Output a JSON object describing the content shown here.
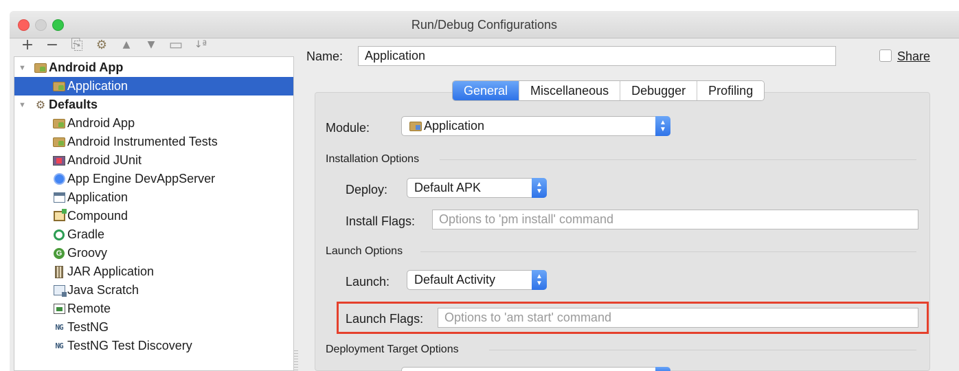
{
  "window": {
    "title": "Run/Debug Configurations"
  },
  "toolbar": {
    "buttons": [
      {
        "name": "add",
        "glyph": "+"
      },
      {
        "name": "remove",
        "glyph": "−"
      },
      {
        "name": "copy",
        "glyph": "⎘"
      },
      {
        "name": "edit-defaults",
        "glyph": "🔧"
      },
      {
        "name": "move-up",
        "glyph": "▲"
      },
      {
        "name": "move-down",
        "glyph": "▼"
      },
      {
        "name": "folder",
        "glyph": "▭"
      },
      {
        "name": "sort",
        "glyph": "↓ª"
      }
    ]
  },
  "tree": {
    "android_app": {
      "label": "Android App"
    },
    "application_selected": {
      "label": "Application"
    },
    "defaults": {
      "label": "Defaults"
    },
    "items": [
      {
        "label": "Android App",
        "icon": "android-app-icon"
      },
      {
        "label": "Android Instrumented Tests",
        "icon": "android-tests-icon"
      },
      {
        "label": "Android JUnit",
        "icon": "junit-icon"
      },
      {
        "label": "App Engine DevAppServer",
        "icon": "app-engine-icon"
      },
      {
        "label": "Application",
        "icon": "application-icon"
      },
      {
        "label": "Compound",
        "icon": "compound-icon"
      },
      {
        "label": "Gradle",
        "icon": "gradle-icon"
      },
      {
        "label": "Groovy",
        "icon": "groovy-icon"
      },
      {
        "label": "JAR Application",
        "icon": "jar-icon"
      },
      {
        "label": "Java Scratch",
        "icon": "java-scratch-icon"
      },
      {
        "label": "Remote",
        "icon": "remote-icon"
      },
      {
        "label": "TestNG",
        "icon": "testng-icon"
      },
      {
        "label": "TestNG Test Discovery",
        "icon": "testng-icon"
      }
    ]
  },
  "form": {
    "name_label": "Name:",
    "name_value": "Application",
    "share_label": "Share",
    "tabs": [
      "General",
      "Miscellaneous",
      "Debugger",
      "Profiling"
    ],
    "active_tab": "General",
    "module_label": "Module:",
    "module_value": "Application",
    "installation_options": "Installation Options",
    "deploy_label": "Deploy:",
    "deploy_value": "Default APK",
    "install_flags_label": "Install Flags:",
    "install_flags_placeholder": "Options to 'pm install' command",
    "launch_options": "Launch Options",
    "launch_label": "Launch:",
    "launch_value": "Default Activity",
    "launch_flags_label": "Launch Flags:",
    "launch_flags_placeholder": "Options to 'am start' command",
    "deployment_target_options": "Deployment Target Options"
  },
  "colors": {
    "selection": "#2f65ca",
    "accent": "#2f73e8",
    "highlight_box": "#e5412d"
  }
}
